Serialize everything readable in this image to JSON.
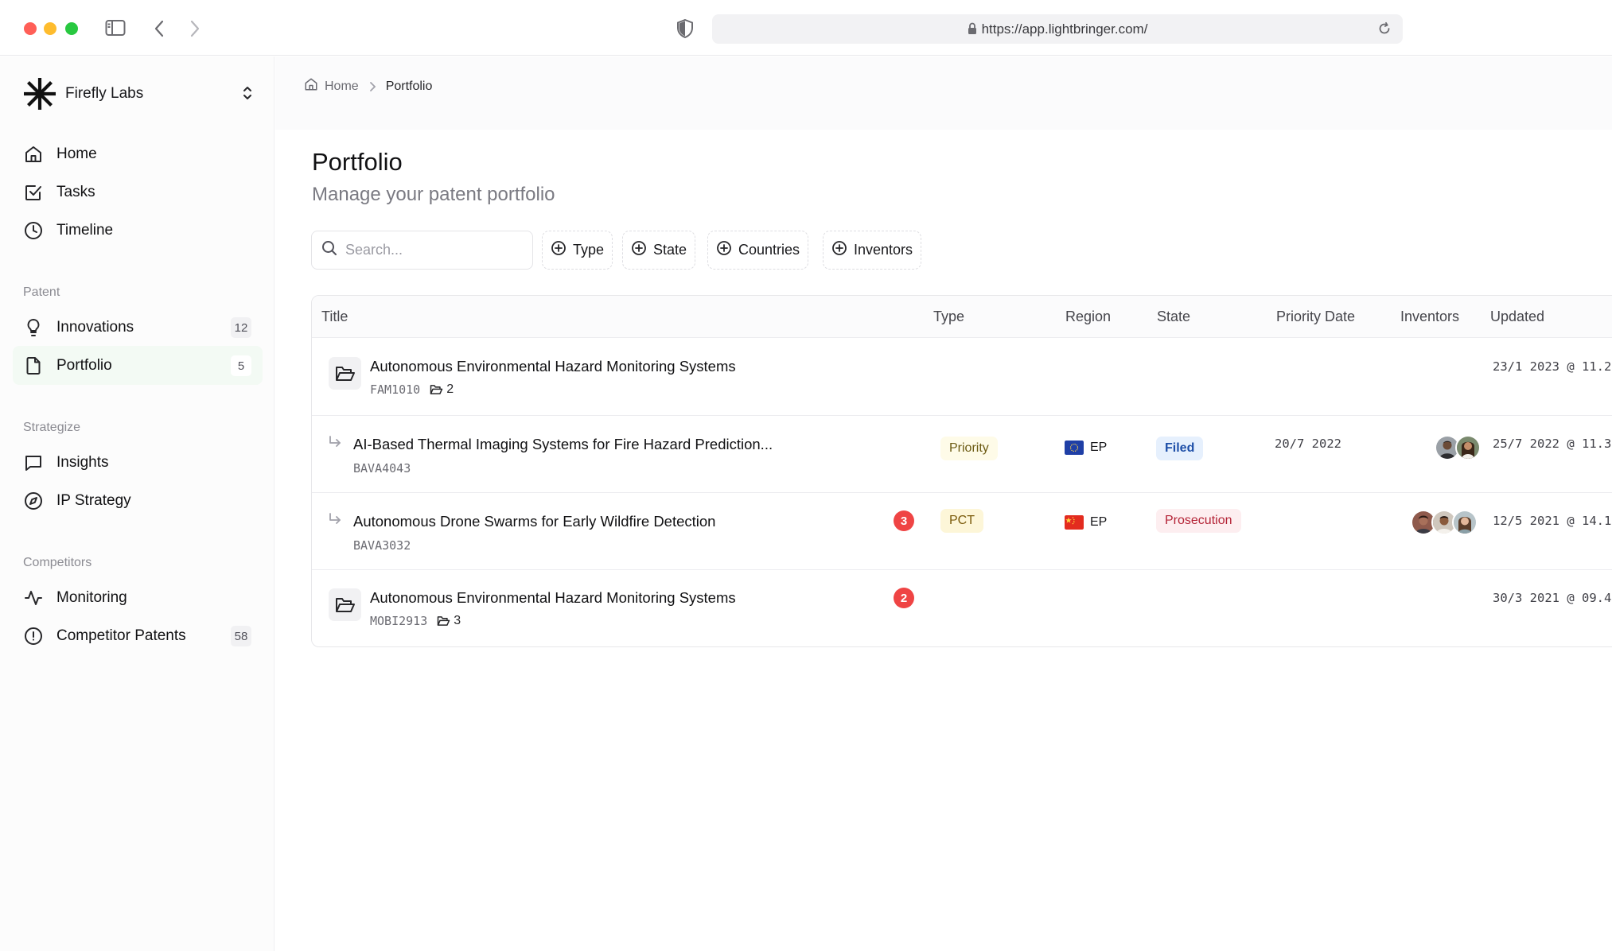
{
  "browser": {
    "url": "https://app.lightbringer.com/"
  },
  "sidebar": {
    "workspace_name": "Firefly Labs",
    "main_items": [
      {
        "label": "Home",
        "icon": "home-icon"
      },
      {
        "label": "Tasks",
        "icon": "checkbox-icon"
      },
      {
        "label": "Timeline",
        "icon": "clock-icon"
      }
    ],
    "sections": [
      {
        "label": "Patent"
      },
      {
        "label": "Strategize"
      },
      {
        "label": "Competitors"
      }
    ],
    "patent_items": [
      {
        "label": "Innovations",
        "count": "12",
        "icon": "lightbulb-icon"
      },
      {
        "label": "Portfolio",
        "count": "5",
        "icon": "document-icon",
        "active": true
      }
    ],
    "strategize_items": [
      {
        "label": "Insights",
        "icon": "chat-icon"
      },
      {
        "label": "IP Strategy",
        "icon": "compass-icon"
      }
    ],
    "competitor_items": [
      {
        "label": "Monitoring",
        "icon": "activity-icon"
      },
      {
        "label": "Competitor Patents",
        "count": "58",
        "icon": "alert-circle-icon"
      }
    ]
  },
  "breadcrumb": {
    "home": "Home",
    "current": "Portfolio"
  },
  "page": {
    "title": "Portfolio",
    "subtitle": "Manage your patent portfolio"
  },
  "toolbar": {
    "search_placeholder": "Search...",
    "filters": [
      "Type",
      "State",
      "Countries",
      "Inventors"
    ]
  },
  "table": {
    "columns": [
      "Title",
      "Type",
      "Region",
      "State",
      "Priority Date",
      "Inventors",
      "Updated"
    ],
    "rows": [
      {
        "kind": "family",
        "title": "Autonomous Environmental Hazard Monitoring Systems",
        "code": "FAM1010",
        "folder_count": "2",
        "updated": "23/1 2023 @ 11.2"
      },
      {
        "kind": "child",
        "title": "AI-Based Thermal Imaging Systems for Fire Hazard Prediction...",
        "code": "BAVA4043",
        "type": "Priority",
        "region": "EP",
        "region_flag": "eu",
        "state": "Filed",
        "priority_date": "20/7 2022",
        "inventor_count": 2,
        "updated": "25/7 2022 @ 11.3"
      },
      {
        "kind": "child",
        "title": "Autonomous Drone Swarms for Early Wildfire Detection",
        "code": "BAVA3032",
        "alerts": "3",
        "type": "PCT",
        "region": "EP",
        "region_flag": "cn",
        "state": "Prosecution",
        "inventor_count": 3,
        "updated": "12/5 2021 @ 14.1"
      },
      {
        "kind": "family",
        "title": "Autonomous Environmental Hazard Monitoring Systems",
        "code": "MOBI2913",
        "folder_count": "3",
        "alerts": "2",
        "updated": "30/3 2021 @ 09.4"
      }
    ]
  },
  "colors": {
    "active_nav_bg": "#f3faf4",
    "alert_red": "#ef4444",
    "filed_blue": "#1e4fa8",
    "prosecution_red": "#b42336"
  }
}
